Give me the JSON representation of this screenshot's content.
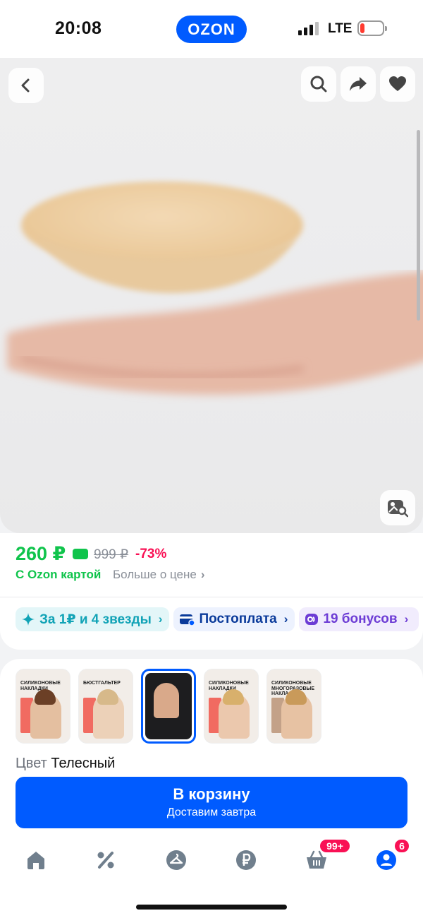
{
  "status_bar": {
    "time": "20:08",
    "logo": "OZON",
    "network": "LTE",
    "battery_level": 0.1
  },
  "gallery": {
    "buttons": {
      "back": "chevron-left-icon",
      "search": "search-icon",
      "share": "share-icon",
      "favorite": "heart-icon",
      "image_search": "image-search-icon"
    }
  },
  "price": {
    "current": "260 ₽",
    "old": "999 ₽",
    "discount": "-73%",
    "ozon_card_text": "С Ozon картой",
    "more_about_price": "Больше о цене",
    "chevron": "›"
  },
  "chips": [
    {
      "label": "За 1₽ и 4 звезды",
      "icon": "sparkle-icon",
      "color": "#11a3b6"
    },
    {
      "label": "Постоплата",
      "icon": "wallet-icon",
      "color": "#0a3a9a"
    },
    {
      "label": "19 бонусов",
      "icon": "bonus-icon",
      "color": "#6d3cd5"
    }
  ],
  "variants": {
    "thumbnails": [
      {
        "caption": "СИЛИКОНОВЫЕ НАКЛАДКИ"
      },
      {
        "caption": "БЮСТГАЛЬТЕР"
      },
      {
        "caption": ""
      },
      {
        "caption": "СИЛИКОНОВЫЕ НАКЛАДКИ"
      },
      {
        "caption": "СИЛИКОНОВЫЕ МНОГОРАЗОВЫЕ НАКЛАДКИ"
      }
    ],
    "selected_index": 2,
    "color_label": "Цвет",
    "color_value": "Телесный"
  },
  "cart_button": {
    "label": "В корзину",
    "sublabel": "Доставим завтра"
  },
  "tabbar": {
    "tabs": [
      "home-icon",
      "percent-icon",
      "hanger-icon",
      "ruble-icon",
      "cart-icon",
      "profile-icon"
    ],
    "cart_badge": "99+",
    "profile_badge": "6"
  },
  "colors": {
    "brand": "#005bff",
    "price_green": "#10c44c",
    "discount_pink": "#f91155"
  }
}
